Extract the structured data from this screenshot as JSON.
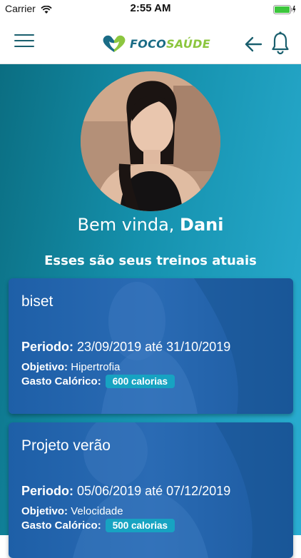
{
  "status_bar": {
    "carrier": "Carrier",
    "time": "2:55 AM"
  },
  "nav": {
    "logo_part1": "FOCO",
    "logo_part2": "SAÚDE",
    "icons": [
      "menu-icon",
      "arrow-left-icon",
      "bell-icon"
    ]
  },
  "profile": {
    "greeting_prefix": "Bem vinda,",
    "name": "Dani"
  },
  "section_title": "Esses são seus treinos atuais",
  "labels": {
    "period": "Periodo:",
    "objective": "Objetivo:",
    "calories": "Gasto Calórico:"
  },
  "workouts": [
    {
      "title": "biset",
      "period": "23/09/2019 até 31/10/2019",
      "objective": "Hipertrofia",
      "calories": "600 calorias"
    },
    {
      "title": "Projeto verão",
      "period": "05/06/2019 até 07/12/2019",
      "objective": "Velocidade",
      "calories": "500 calorias"
    }
  ],
  "colors": {
    "brand_dark": "#1a6c86",
    "brand_green": "#8cc63f",
    "badge": "#17a3c2",
    "card": "#2a6bb4"
  }
}
